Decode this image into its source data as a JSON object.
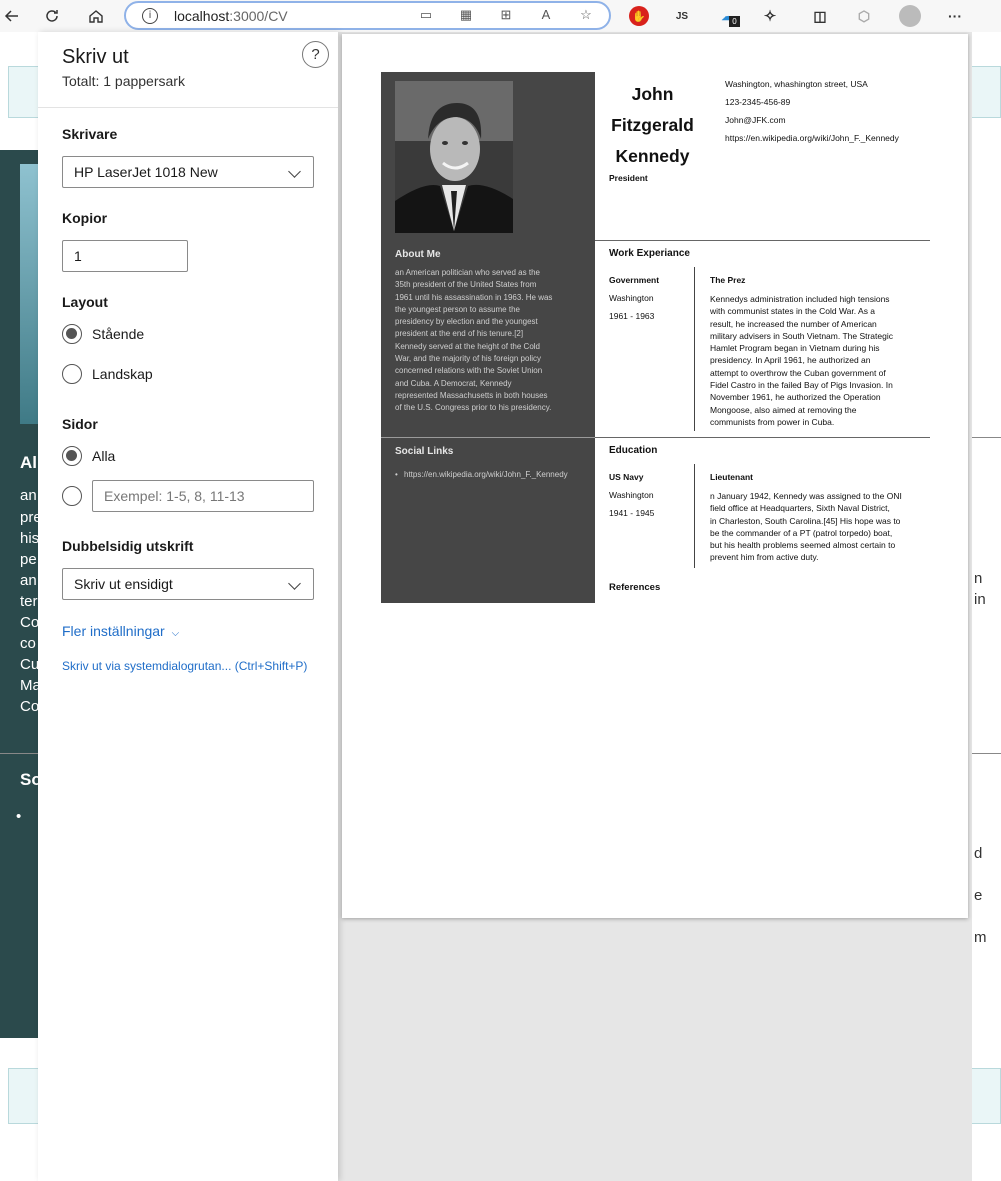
{
  "browser": {
    "url_host": "localhost",
    "url_path": ":3000/CV",
    "ext_js": "JS",
    "ext_badge": "0",
    "menu": "···"
  },
  "background": {
    "left_heading_fragment": "Al",
    "left_text_fragments": [
      "an",
      "pre",
      "his",
      "pe",
      "an",
      "ter",
      "Co",
      "co",
      "Cu",
      "Ma",
      "Co"
    ],
    "left_heading2_fragment": "So",
    "right_fragments": [
      "n",
      "in",
      "d",
      "e",
      "m"
    ]
  },
  "print_panel": {
    "title": "Skriv ut",
    "total": "Totalt: 1 pappersark",
    "help": "?",
    "printer_label": "Skrivare",
    "printer_value": "HP LaserJet 1018 New",
    "copies_label": "Kopior",
    "copies_value": "1",
    "layout_label": "Layout",
    "layout_portrait": "Stående",
    "layout_landscape": "Landskap",
    "pages_label": "Sidor",
    "pages_all": "Alla",
    "pages_custom_placeholder": "Exempel: 1-5, 8, 11-13",
    "duplex_label": "Dubbelsidig utskrift",
    "duplex_value": "Skriv ut ensidigt",
    "more_settings": "Fler inställningar",
    "system_dialog": "Skriv ut via systemdialogrutan... (Ctrl+Shift+P)"
  },
  "cv": {
    "name_lines": [
      "John",
      "Fitzgerald",
      "Kennedy"
    ],
    "role": "President",
    "contact": [
      "Washington, whashington street, USA",
      "123-2345-456-89",
      "John@JFK.com",
      "https://en.wikipedia.org/wiki/John_F._Kennedy"
    ],
    "about_heading": "About Me",
    "about_lines": [
      "an American politician who served as the",
      "35th president of the United States from",
      "1961 until his assassination in 1963. He was",
      "the youngest person to assume the",
      "presidency by election and the youngest",
      "president at the end of his tenure.[2]",
      "Kennedy served at the height of the Cold",
      "War, and the majority of his foreign policy",
      "concerned relations with the Soviet Union",
      "and Cuba. A Democrat, Kennedy",
      "represented Massachusetts in both houses",
      "of the U.S. Congress prior to his presidency."
    ],
    "social_heading": "Social Links",
    "social_link": "https://en.wikipedia.org/wiki/John_F._Kennedy",
    "work_heading": "Work Experiance",
    "work": {
      "org": "Government",
      "location": "Washington",
      "years": "1961 - 1963",
      "title": "The Prez",
      "desc_lines": [
        "Kennedys administration included high tensions",
        "with communist states in the Cold War. As a",
        "result, he increased the number of American",
        "military advisers in South Vietnam. The Strategic",
        "Hamlet Program began in Vietnam during his",
        "presidency. In April 1961, he authorized an",
        "attempt to overthrow the Cuban government of",
        "Fidel Castro in the failed Bay of Pigs Invasion. In",
        "November 1961, he authorized the Operation",
        "Mongoose, also aimed at removing the",
        "communists from power in Cuba."
      ]
    },
    "education_heading": "Education",
    "education": {
      "org": "US Navy",
      "location": "Washington",
      "years": "1941 - 1945",
      "title": "Lieutenant",
      "desc_lines": [
        "n January 1942, Kennedy was assigned to the ONI",
        "field office at Headquarters, Sixth Naval District,",
        "in Charleston, South Carolina.[45] His hope was to",
        "be the commander of a PT (patrol torpedo) boat,",
        "but his health problems seemed almost certain to",
        "prevent him from active duty."
      ]
    },
    "references_heading": "References"
  }
}
